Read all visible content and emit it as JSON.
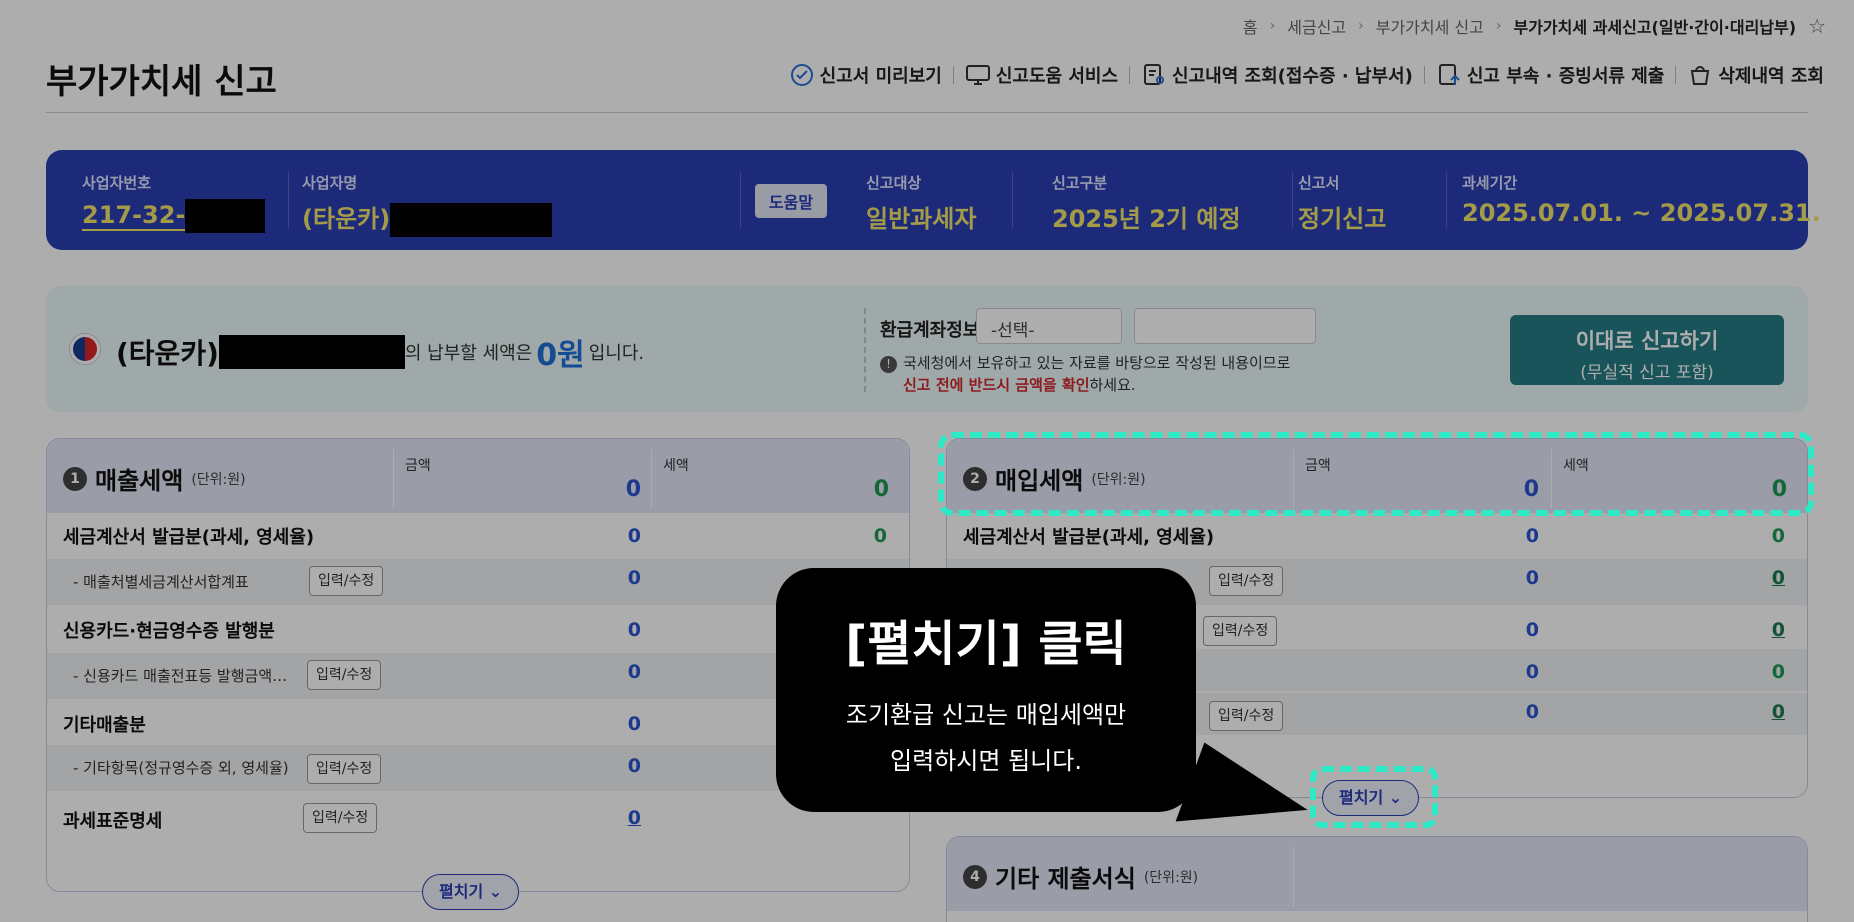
{
  "breadcrumb": {
    "items": [
      "홈",
      "세금신고",
      "부가가치세 신고"
    ],
    "current": "부가가치세 과세신고(일반·간이·대리납부)"
  },
  "page_title": "부가가치세 신고",
  "toolbar": {
    "preview": "신고서 미리보기",
    "help_service": "신고도움 서비스",
    "history": "신고내역 조회(접수증 · 납부서)",
    "attach": "신고 부속 · 증빙서류 제출",
    "deleted": "삭제내역 조회"
  },
  "info_bar": {
    "biz_no_label": "사업자번호",
    "biz_no_value": "217-32-",
    "biz_name_label": "사업자명",
    "biz_name_value": "(타운카)",
    "help_button": "도움말",
    "target_label": "신고대상",
    "target_value": "일반과세자",
    "type_label": "신고구분",
    "type_value": "2025년 2기 예정",
    "form_label": "신고서",
    "form_value": "정기신고",
    "period_label": "과세기간",
    "period_value": "2025.07.01. ~ 2025.07.31."
  },
  "summary": {
    "company": "(타운카)",
    "text_before": "의 납부할 세액은",
    "amount": "0원",
    "text_after": "입니다.",
    "refund_label": "환급계좌정보",
    "refund_select": "-선택-",
    "note_line1": "국세청에서 보유하고 있는 자료를 바탕으로 작성된 내용이므로",
    "note_red": "신고 전에 반드시 금액을 확인",
    "note_tail": "하세요.",
    "submit_line1": "이대로 신고하기",
    "submit_line2": "(무실적 신고 포함)"
  },
  "sales": {
    "num": "1",
    "title": "매출세액",
    "unit": "(단위:원)",
    "col_amount": "금액",
    "col_tax": "세액",
    "total_amount": "0",
    "total_tax": "0",
    "row1_label": "세금계산서 발급분(과세, 영세율)",
    "row1_amount": "0",
    "row1_tax": "0",
    "row1_sub": "- 매출처별세금계산서합계표",
    "row1_sub_amount": "0",
    "row2_label": "신용카드·현금영수증 발행분",
    "row2_amount": "0",
    "row2_sub": "- 신용카드 매출전표등 발행금액…",
    "row2_sub_amount": "0",
    "row3_label": "기타매출분",
    "row3_amount": "0",
    "row3_sub": "- 기타항목(정규영수증 외, 영세율)",
    "row3_sub_amount": "0",
    "row4_label": "과세표준명세",
    "row4_amount": "0",
    "edit": "입력/수정",
    "expand": "펼치기"
  },
  "purchase": {
    "num": "2",
    "title": "매입세액",
    "unit": "(단위:원)",
    "col_amount": "금액",
    "col_tax": "세액",
    "total_amount": "0",
    "total_tax": "0",
    "row1_label": "세금계산서 발급분(과세, 영세율)",
    "row1_amount": "0",
    "row1_tax": "0",
    "r2_amount": "0",
    "r2_tax": "0",
    "r3_amount": "0",
    "r3_tax": "0",
    "r4_amount": "0",
    "r4_tax": "0",
    "r5_amount": "0",
    "r5_tax": "0",
    "edit": "입력/수정",
    "expand": "펼치기"
  },
  "other": {
    "num": "4",
    "title": "기타 제출서식",
    "unit": "(단위:원)"
  },
  "callout": {
    "heading": "[펼치기] 클릭",
    "line1": "조기환급 신고는 매입세액만",
    "line2": "입력하시면 됩니다."
  }
}
